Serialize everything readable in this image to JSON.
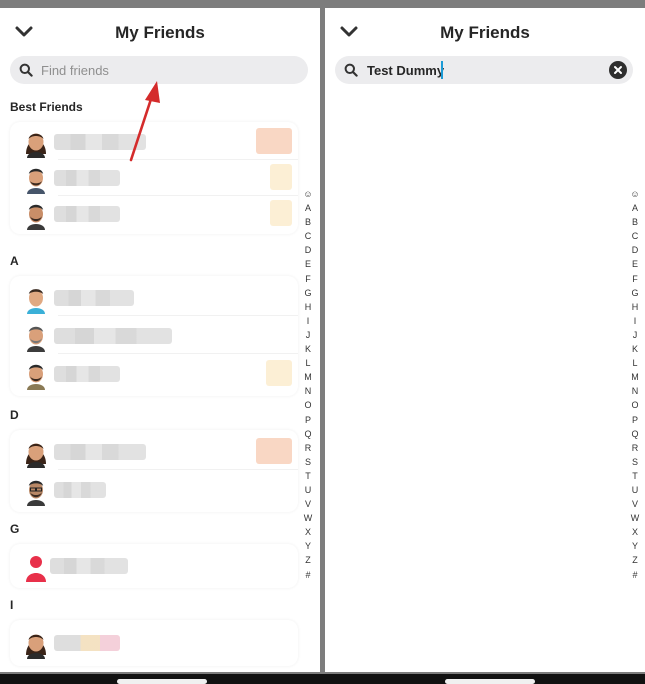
{
  "left": {
    "title": "My Friends",
    "search": {
      "placeholder": "Find friends"
    },
    "sections": {
      "best": "Best Friends",
      "a": "A",
      "d": "D",
      "g": "G",
      "i": "I"
    }
  },
  "right": {
    "title": "My Friends",
    "search": {
      "value": "Test Dummy"
    }
  },
  "alphabet_index": [
    "☺",
    "A",
    "B",
    "C",
    "D",
    "E",
    "F",
    "G",
    "H",
    "I",
    "J",
    "K",
    "L",
    "M",
    "N",
    "O",
    "P",
    "Q",
    "R",
    "S",
    "T",
    "U",
    "V",
    "W",
    "X",
    "Y",
    "Z",
    "#"
  ],
  "icons": {
    "collapse": "chevron-down-icon",
    "search": "magnifier-icon",
    "clear": "clear-x-icon",
    "avatar": "bitmoji-avatar-icon",
    "avatar_placeholder": "default-person-icon",
    "pointer": "red-arrow-annotation"
  },
  "colors": {
    "search_bg": "#ececee",
    "cursor": "#1c9bd6",
    "arrow": "#d42b2b",
    "placeholder_avatar": "#e8304a"
  }
}
